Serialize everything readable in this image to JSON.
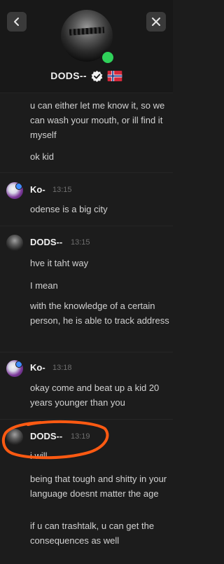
{
  "header": {
    "back_icon": "chevron-left-icon",
    "close_icon": "close-icon",
    "username": "DODS--",
    "status_color": "#2fd15a",
    "badge_icon": "verified-check-icon",
    "flag_icon": "norway-flag-icon"
  },
  "messages": [
    {
      "author": "",
      "time": "",
      "lines": [
        "u can either let me know it, so we can wash your mouth, or ill find it myself",
        "ok kid"
      ]
    },
    {
      "author": "Ko-",
      "time": "13:15",
      "lines": [
        "odense is a big city"
      ]
    },
    {
      "author": "DODS--",
      "time": "13:15",
      "lines": [
        "hve it taht way",
        "I mean",
        "with the knowledge of a certain person, he is able to track address"
      ]
    },
    {
      "author": "Ko-",
      "time": "13:18",
      "lines": [
        "okay come and beat up a kid 20 years younger than you"
      ]
    },
    {
      "author": "DODS--",
      "time": "13:19",
      "lines": [
        "i will",
        "being that tough and shitty in your language doesnt matter the age",
        "if u can trashtalk, u can get the consequences as well"
      ]
    }
  ],
  "annotation_color": "#ff5a12"
}
